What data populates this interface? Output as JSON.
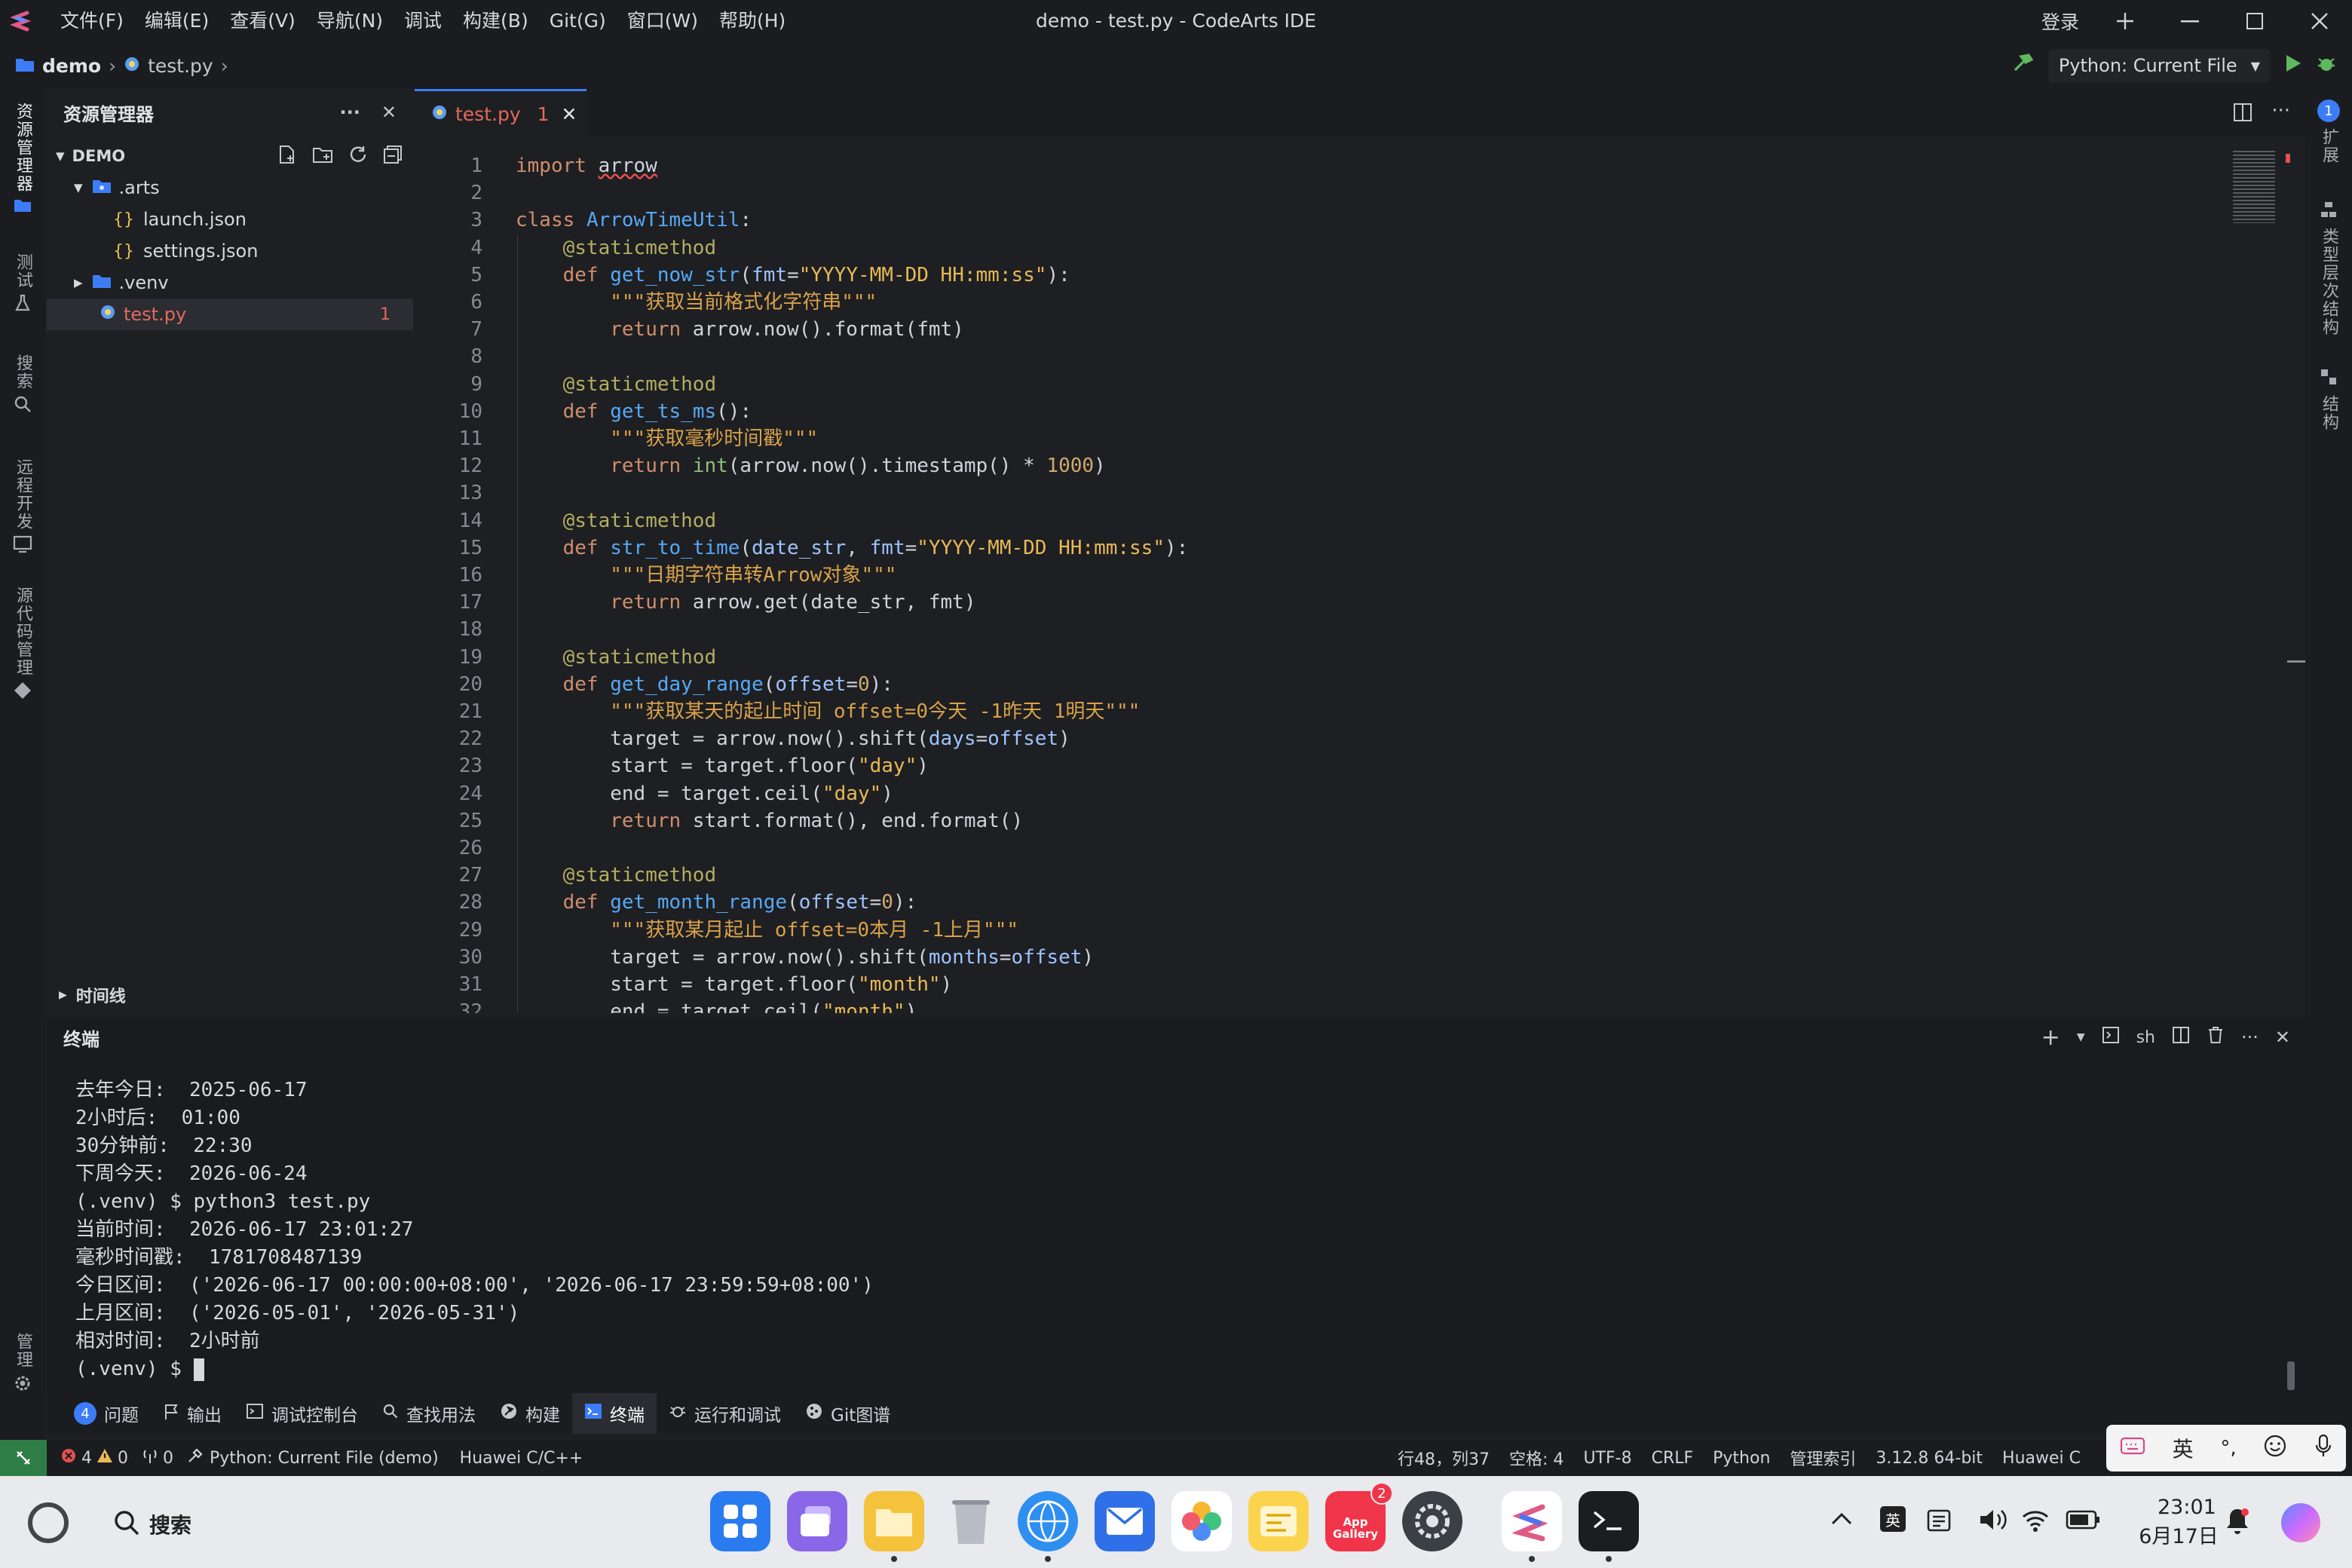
{
  "window": {
    "title": "demo - test.py - CodeArts IDE",
    "login": "登录"
  },
  "menu": [
    "文件(F)",
    "编辑(E)",
    "查看(V)",
    "导航(N)",
    "调试",
    "构建(B)",
    "Git(G)",
    "窗口(W)",
    "帮助(H)"
  ],
  "breadcrumb": {
    "project": "demo",
    "file": "test.py"
  },
  "run_config": {
    "label": "Python: Current File"
  },
  "activity": {
    "explorer": "资源管理器",
    "test": "测试",
    "search": "搜索",
    "remote": "远程开发",
    "scm": "源代码管理",
    "manage": "管理"
  },
  "right_activity": {
    "ext": "扩展",
    "hierarchy": "类型层次结构",
    "structure": "结构"
  },
  "explorer": {
    "title": "资源管理器",
    "root": "DEMO",
    "items": [
      {
        "name": ".arts",
        "kind": "folder"
      },
      {
        "name": "launch.json",
        "kind": "json"
      },
      {
        "name": "settings.json",
        "kind": "json"
      },
      {
        "name": ".venv",
        "kind": "folder"
      },
      {
        "name": "test.py",
        "kind": "py",
        "badge": "1"
      }
    ],
    "timeline": "时间线"
  },
  "tab": {
    "name": "test.py",
    "badge": "1"
  },
  "code_lines": [
    "import arrow",
    "",
    "class ArrowTimeUtil:",
    "    @staticmethod",
    "    def get_now_str(fmt=\"YYYY-MM-DD HH:mm:ss\"):",
    "        \"\"\"获取当前格式化字符串\"\"\"",
    "        return arrow.now().format(fmt)",
    "",
    "    @staticmethod",
    "    def get_ts_ms():",
    "        \"\"\"获取毫秒时间戳\"\"\"",
    "        return int(arrow.now().timestamp() * 1000)",
    "",
    "    @staticmethod",
    "    def str_to_time(date_str, fmt=\"YYYY-MM-DD HH:mm:ss\"):",
    "        \"\"\"日期字符串转Arrow对象\"\"\"",
    "        return arrow.get(date_str, fmt)",
    "",
    "    @staticmethod",
    "    def get_day_range(offset=0):",
    "        \"\"\"获取某天的起止时间 offset=0今天 -1昨天 1明天\"\"\"",
    "        target = arrow.now().shift(days=offset)",
    "        start = target.floor(\"day\")",
    "        end = target.ceil(\"day\")",
    "        return start.format(), end.format()",
    "",
    "    @staticmethod",
    "    def get_month_range(offset=0):",
    "        \"\"\"获取某月起止 offset=0本月 -1上月\"\"\"",
    "        target = arrow.now().shift(months=offset)",
    "        start = target.floor(\"month\")",
    "        end = target.ceil(\"month\")"
  ],
  "terminal": {
    "title": "终端",
    "shell": "sh",
    "lines": [
      "去年今日:  2025-06-17",
      "2小时后:  01:00",
      "30分钟前:  22:30",
      "下周今天:  2026-06-24",
      "(.venv) $ python3 test.py",
      "当前时间:  2026-06-17 23:01:27",
      "毫秒时间戳:  1781708487139",
      "今日区间:  ('2026-06-17 00:00:00+08:00', '2026-06-17 23:59:59+08:00')",
      "上月区间:  ('2026-05-01', '2026-05-31')",
      "相对时间:  2小时前",
      "(.venv) $ "
    ]
  },
  "panel_tabs": {
    "problems_count": "4",
    "problems": "问题",
    "output": "输出",
    "debug_console": "调试控制台",
    "find_usages": "查找用法",
    "build": "构建",
    "terminal": "终端",
    "run_debug": "运行和调试",
    "git_graph": "Git图谱"
  },
  "status": {
    "errors": "4",
    "warnings": "0",
    "radio": "0",
    "interpreter": "Python: Current File (demo)",
    "cpp": "Huawei C/C++",
    "position": "行48，列37",
    "indent": "空格: 4",
    "encoding": "UTF-8",
    "eol": "CRLF",
    "lang": "Python",
    "index": "管理索引",
    "pyver": "3.12.8 64-bit",
    "huawei": "Huawei C"
  },
  "ime": {
    "lang": "英"
  },
  "taskbar": {
    "search": "搜索",
    "appgallery": "App Gallery",
    "appgallery_badge": "2",
    "ime": "英",
    "time": "23:01",
    "date": "6月17日"
  },
  "colors": {
    "accent": "#3d7cf7",
    "error": "#e25050",
    "bg": "#1e1f22"
  }
}
